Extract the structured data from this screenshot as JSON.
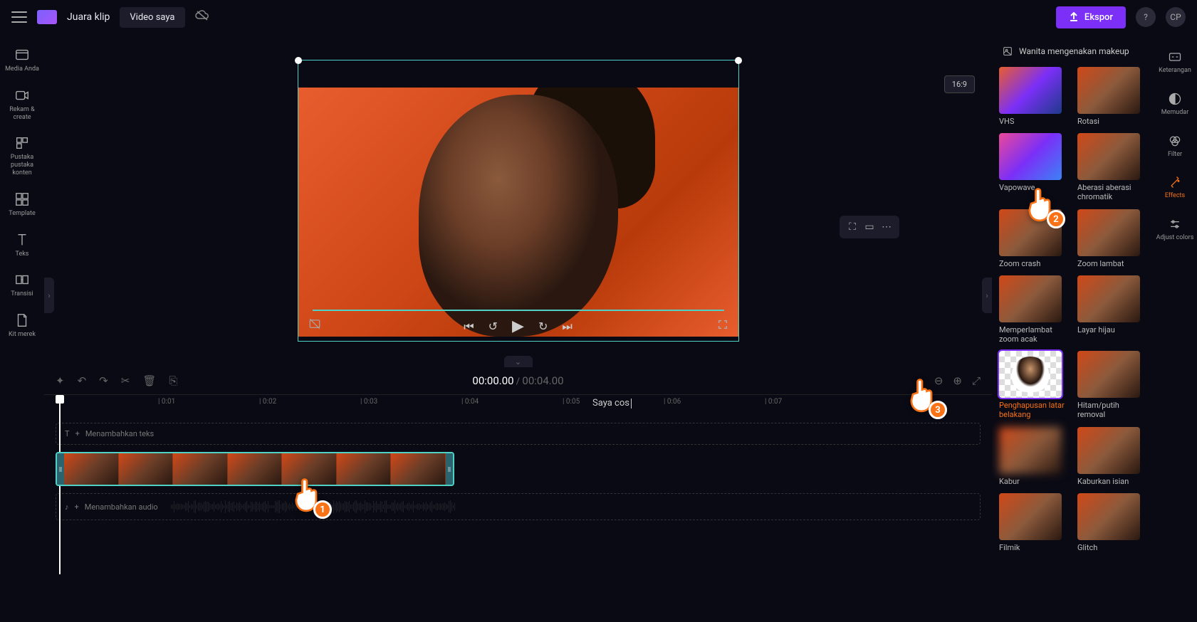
{
  "topbar": {
    "brand": "Juara klip",
    "tab": "Video saya",
    "export": "Ekspor",
    "avatar": "CP"
  },
  "left_sidebar": {
    "items": [
      {
        "label": "Media Anda",
        "icon": "folder"
      },
      {
        "label": "Rekam &\ncreate",
        "icon": "camera"
      },
      {
        "label": "Pustaka pustaka\nkonten",
        "icon": "library"
      },
      {
        "label": "Template",
        "icon": "grid"
      },
      {
        "label": "Teks",
        "icon": "text"
      },
      {
        "label": "Transisi",
        "icon": "transition"
      },
      {
        "label": "Kit merek",
        "icon": "brand"
      }
    ]
  },
  "canvas": {
    "aspect": "16:9",
    "time_current": "00:00.00",
    "time_total": "00:04.00"
  },
  "right_panel": {
    "search_text": "Wanita mengenakan makeup",
    "effects": [
      {
        "label": "VHS",
        "thumb": "vhs"
      },
      {
        "label": "Rotasi",
        "thumb": "std"
      },
      {
        "label": "Vapowave",
        "thumb": "vapor"
      },
      {
        "label": "Aberasi aberasi chromatik",
        "thumb": "std"
      },
      {
        "label": "Zoom crash",
        "thumb": "std"
      },
      {
        "label": "Zoom lambat",
        "thumb": "std"
      },
      {
        "label": "Memperlambat zoom acak",
        "thumb": "std"
      },
      {
        "label": "Layar hijau",
        "thumb": "std"
      },
      {
        "label": "Penghapusan latar belakang",
        "thumb": "bg-remove",
        "selected": true,
        "highlight": true
      },
      {
        "label": "Hitam/putih removal",
        "thumb": "std"
      },
      {
        "label": "Kabur",
        "thumb": "blur"
      },
      {
        "label": "Kaburkan isian",
        "thumb": "std"
      },
      {
        "label": "Filmik",
        "thumb": "std"
      },
      {
        "label": "Glitch",
        "thumb": "std"
      }
    ]
  },
  "far_sidebar": {
    "items": [
      {
        "label": "Keterangan",
        "icon": "cc"
      },
      {
        "label": "Memudar",
        "icon": "fade"
      },
      {
        "label": "Filter",
        "icon": "filter"
      },
      {
        "label": "Effects",
        "icon": "fx",
        "active": true
      },
      {
        "label": "Adjust\ncolors",
        "icon": "adjust"
      }
    ]
  },
  "timeline": {
    "ticks": [
      "0:01",
      "0:02",
      "0:03",
      "0:04",
      "0:05",
      "0:06",
      "0:07"
    ],
    "typing": "Saya cos",
    "add_text": "Menambahkan teks",
    "add_audio": "Menambahkan audio"
  },
  "cursors": {
    "c1": "1",
    "c2": "2",
    "c3": "3"
  }
}
